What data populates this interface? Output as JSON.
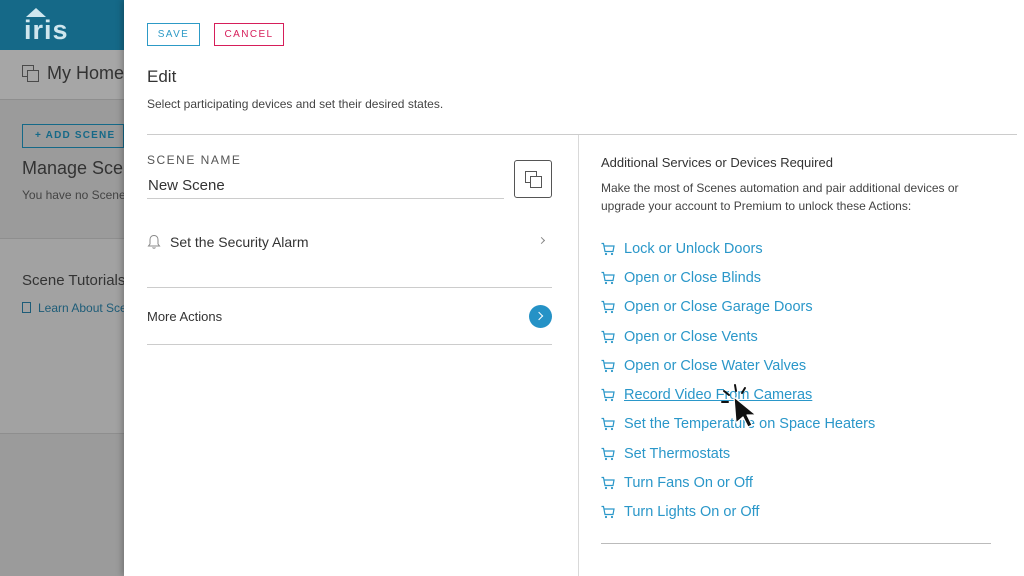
{
  "background": {
    "logo": "iris",
    "home_title": "My Home",
    "add_scene_label": "+ ADD SCENE",
    "manage_title": "Manage Scenes",
    "no_scenes_text": "You have no Scenes",
    "tutorials_title": "Scene Tutorials",
    "learn_link": "Learn About Scenes"
  },
  "panel": {
    "save_label": "SAVE",
    "cancel_label": "CANCEL",
    "edit_title": "Edit",
    "edit_subtitle": "Select participating devices and set their desired states.",
    "scene_name_label": "SCENE NAME",
    "scene_name_value": "New Scene",
    "security_alarm_label": "Set the Security Alarm",
    "more_actions_label": "More Actions"
  },
  "additional": {
    "title": "Additional Services or Devices Required",
    "description": "Make the most of Scenes automation and pair additional devices or upgrade your account to Premium to unlock these Actions:",
    "actions": [
      "Lock or Unlock Doors",
      "Open or Close Blinds",
      "Open or Close Garage Doors",
      "Open or Close Vents",
      "Open or Close Water Valves",
      "Record Video From Cameras",
      "Set the Temperature on Space Heaters",
      "Set Thermostats",
      "Turn Fans On or Off",
      "Turn Lights On or Off"
    ],
    "hovered_index": 5
  },
  "colors": {
    "header": "#156988",
    "accent": "#2d9ac6",
    "cancel": "#d61e5a",
    "link": "#2a97c9"
  }
}
